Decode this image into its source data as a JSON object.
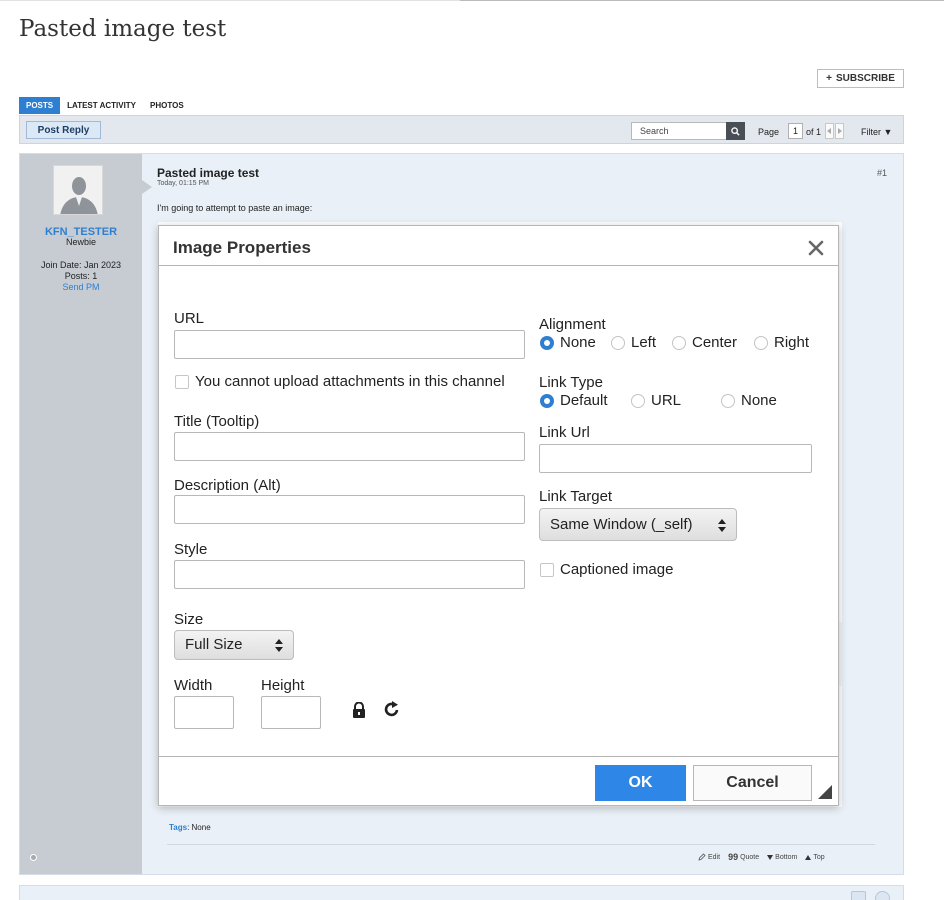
{
  "page": {
    "title": "Pasted image test"
  },
  "subscribe": {
    "plus": "+",
    "label": "SUBSCRIBE"
  },
  "tabs": [
    {
      "label": "POSTS",
      "active": true
    },
    {
      "label": "LATEST ACTIVITY",
      "active": false
    },
    {
      "label": "PHOTOS",
      "active": false
    }
  ],
  "toolbar": {
    "post_reply": "Post Reply",
    "search_placeholder": "Search",
    "page_label": "Page",
    "page_value": "1",
    "page_of": "of 1",
    "filter": "Filter ▼",
    "search_icon": "search-icon"
  },
  "user": {
    "name": "KFN_TESTER",
    "title": "Newbie",
    "join_date": "Join Date: Jan 2023",
    "posts": "Posts: 1",
    "send_pm": "Send PM",
    "status_icon": "online-status-icon"
  },
  "post": {
    "title": "Pasted image test",
    "date": "Today, 01:15 PM",
    "number": "#1",
    "body": "I'm going to attempt to paste an image:",
    "tags_label": "Tags",
    "tags_value": ": None",
    "controls": {
      "edit": "Edit",
      "quote": "Quote",
      "bottom": "Bottom",
      "top": "Top"
    }
  },
  "dialog": {
    "title": "Image Properties",
    "url_label": "URL",
    "url_value": "",
    "upload_note": "You cannot upload attachments in this channel",
    "title_label": "Title (Tooltip)",
    "description_label": "Description (Alt)",
    "style_label": "Style",
    "size_label": "Size",
    "size_value": "Full Size",
    "width_label": "Width",
    "height_label": "Height",
    "alignment_label": "Alignment",
    "alignment_options": [
      "None",
      "Left",
      "Center",
      "Right"
    ],
    "alignment_selected": "None",
    "link_type_label": "Link Type",
    "link_type_options": [
      "Default",
      "URL",
      "None"
    ],
    "link_type_selected": "Default",
    "link_url_label": "Link Url",
    "link_target_label": "Link Target",
    "link_target_value": "Same Window (_self)",
    "captioned_label": "Captioned image",
    "captioned_checked": false,
    "ok": "OK",
    "cancel": "Cancel"
  },
  "colors": {
    "accent": "#2e7fd1",
    "ok_button": "#2e87e6",
    "post_bg": "#e9f0f7",
    "user_col_bg": "#c6ccd2"
  }
}
